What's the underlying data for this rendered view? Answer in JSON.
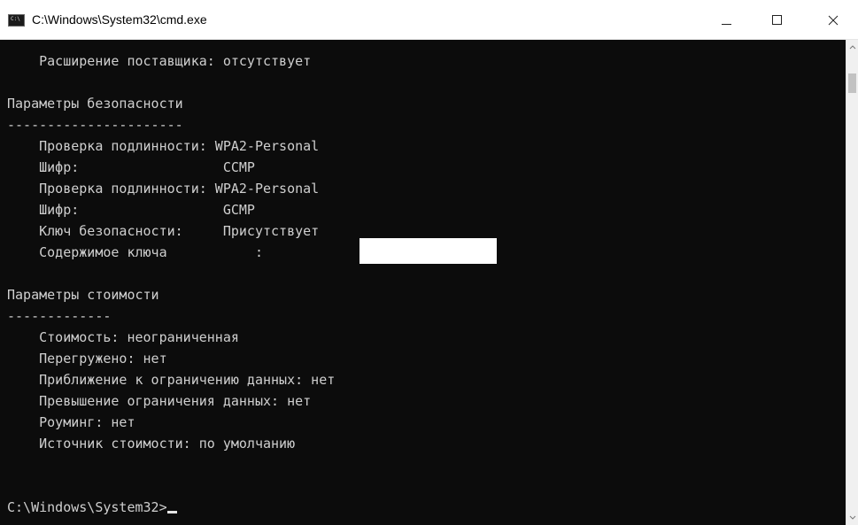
{
  "window": {
    "title": "C:\\Windows\\System32\\cmd.exe",
    "icon_name": "cmd-icon",
    "icon_text": "C:\\"
  },
  "controls": [
    {
      "name": "minimize-button",
      "icon": "minimize-icon"
    },
    {
      "name": "maximize-button",
      "icon": "maximize-icon"
    },
    {
      "name": "close-button",
      "icon": "close-icon"
    }
  ],
  "console": {
    "lines": [
      "    Расширение поставщика: отсутствует",
      "",
      "Параметры безопасности",
      "----------------------",
      "    Проверка подлинности: WPA2-Personal",
      "    Шифр:                  CCMP",
      "    Проверка подлинности: WPA2-Personal",
      "    Шифр:                  GCMP",
      "    Ключ безопасности:     Присутствует",
      "    Содержимое ключа           :",
      "",
      "Параметры стоимости",
      "-------------",
      "    Стоимость: неограниченная",
      "    Перегружено: нет",
      "    Приближение к ограничению данных: нет",
      "    Превышение ограничения данных: нет",
      "    Роуминг: нет",
      "    Источник стоимости: по умолчанию",
      "",
      "",
      "C:\\Windows\\System32>"
    ]
  },
  "colors": {
    "console_bg": "#0c0c0c",
    "console_text": "#cfcfcf",
    "titlebar_bg": "#ffffff",
    "redaction": "#ffffff"
  }
}
